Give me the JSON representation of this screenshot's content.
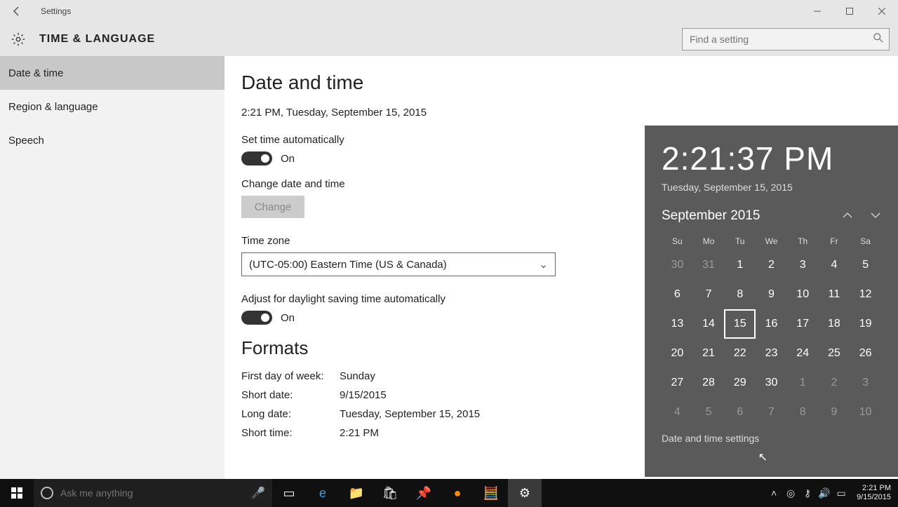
{
  "window": {
    "title": "Settings"
  },
  "header": {
    "category": "TIME & LANGUAGE"
  },
  "search": {
    "placeholder": "Find a setting"
  },
  "sidebar": {
    "items": [
      {
        "label": "Date & time",
        "selected": true
      },
      {
        "label": "Region & language",
        "selected": false
      },
      {
        "label": "Speech",
        "selected": false
      }
    ]
  },
  "main": {
    "heading": "Date and time",
    "current": "2:21 PM, Tuesday, September 15, 2015",
    "set_auto": {
      "label": "Set time automatically",
      "state": "On"
    },
    "change": {
      "label": "Change date and time",
      "button": "Change"
    },
    "timezone": {
      "label": "Time zone",
      "value": "(UTC-05:00) Eastern Time (US & Canada)"
    },
    "dst": {
      "label": "Adjust for daylight saving time automatically",
      "state": "On"
    },
    "formats": {
      "heading": "Formats",
      "first_day": {
        "k": "First day of week:",
        "v": "Sunday"
      },
      "short_date": {
        "k": "Short date:",
        "v": "9/15/2015"
      },
      "long_date": {
        "k": "Long date:",
        "v": "Tuesday, September 15, 2015"
      },
      "short_time": {
        "k": "Short time:",
        "v": "2:21 PM"
      }
    }
  },
  "flyout": {
    "time": "2:21:37 PM",
    "date": "Tuesday, September 15, 2015",
    "month": "September 2015",
    "dow": [
      "Su",
      "Mo",
      "Tu",
      "We",
      "Th",
      "Fr",
      "Sa"
    ],
    "weeks": [
      [
        {
          "n": "30",
          "dim": true
        },
        {
          "n": "31",
          "dim": true
        },
        {
          "n": "1"
        },
        {
          "n": "2"
        },
        {
          "n": "3"
        },
        {
          "n": "4"
        },
        {
          "n": "5"
        }
      ],
      [
        {
          "n": "6"
        },
        {
          "n": "7"
        },
        {
          "n": "8"
        },
        {
          "n": "9"
        },
        {
          "n": "10"
        },
        {
          "n": "11"
        },
        {
          "n": "12"
        }
      ],
      [
        {
          "n": "13"
        },
        {
          "n": "14"
        },
        {
          "n": "15",
          "today": true
        },
        {
          "n": "16"
        },
        {
          "n": "17"
        },
        {
          "n": "18"
        },
        {
          "n": "19"
        }
      ],
      [
        {
          "n": "20"
        },
        {
          "n": "21"
        },
        {
          "n": "22"
        },
        {
          "n": "23"
        },
        {
          "n": "24"
        },
        {
          "n": "25"
        },
        {
          "n": "26"
        }
      ],
      [
        {
          "n": "27"
        },
        {
          "n": "28"
        },
        {
          "n": "29"
        },
        {
          "n": "30"
        },
        {
          "n": "1",
          "dim": true
        },
        {
          "n": "2",
          "dim": true
        },
        {
          "n": "3",
          "dim": true
        }
      ],
      [
        {
          "n": "4",
          "dim": true
        },
        {
          "n": "5",
          "dim": true
        },
        {
          "n": "6",
          "dim": true
        },
        {
          "n": "7",
          "dim": true
        },
        {
          "n": "8",
          "dim": true
        },
        {
          "n": "9",
          "dim": true
        },
        {
          "n": "10",
          "dim": true
        }
      ]
    ],
    "link": "Date and time settings"
  },
  "cortana": {
    "placeholder": "Ask me anything"
  },
  "tray": {
    "time": "2:21 PM",
    "date": "9/15/2015"
  }
}
